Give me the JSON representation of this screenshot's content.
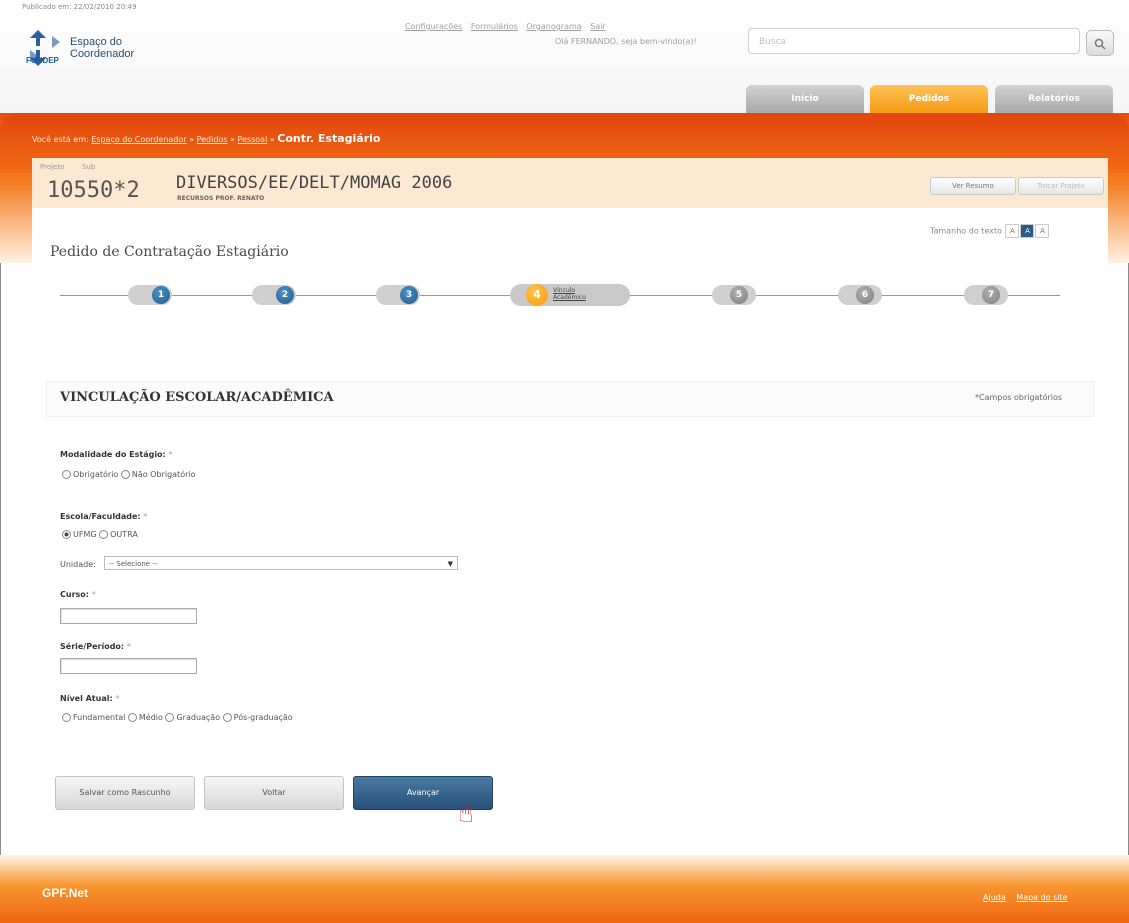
{
  "header": {
    "published": "Publicado em: 22/02/2010 20:49",
    "logo_text_line1": "Espaço do",
    "logo_text_line2": "Coordenador",
    "logo_brand": "FUNDEP",
    "links": [
      "Configurações",
      "Formulários",
      "Organograma",
      "Sair"
    ],
    "greeting": "Olá FERNANDO, seja bem-vindo(a)!",
    "search_placeholder": "Busca"
  },
  "tabs": [
    {
      "label": "Início",
      "active": false
    },
    {
      "label": "Pedidos",
      "active": true
    },
    {
      "label": "Relatórios",
      "active": false
    }
  ],
  "breadcrumb": {
    "prefix": "Você está em:",
    "items": [
      "Espaço do Coordenador",
      "Pedidos",
      "Pessoal"
    ],
    "separator": "»",
    "current": "Contr. Estagiário"
  },
  "project": {
    "projeto_label": "Projeto",
    "sub_label": "Sub",
    "number": "10550*2",
    "name": "DIVERSOS/EE/DELT/MOMAG 2006",
    "subtitle": "RECURSOS PROF. RENATO",
    "ver_resumo": "Ver Resumo",
    "trocar_projeto": "Trocar Projeto"
  },
  "text_size": {
    "label": "Tamanho do texto",
    "options": [
      "A",
      "A",
      "A"
    ],
    "active_index": 1
  },
  "page_title": "Pedido de Contratação Estagiário",
  "steps": [
    {
      "num": "1",
      "state": "done"
    },
    {
      "num": "2",
      "state": "done"
    },
    {
      "num": "3",
      "state": "done"
    },
    {
      "num": "4",
      "state": "current",
      "label_line1": "Vínculo",
      "label_line2": "Acadêmico"
    },
    {
      "num": "5",
      "state": "pending"
    },
    {
      "num": "6",
      "state": "pending"
    },
    {
      "num": "7",
      "state": "pending"
    }
  ],
  "section": {
    "title": "VINCULAÇÃO ESCOLAR/ACADÊMICA",
    "required_note": "*Campos obrigatórios"
  },
  "form": {
    "modalidade": {
      "label": "Modalidade do Estágio:",
      "options": [
        "Obrigatório",
        "Não Obrigatório"
      ],
      "selected": null
    },
    "escola": {
      "label": "Escola/Faculdade:",
      "options": [
        "UFMG",
        "OUTRA"
      ],
      "selected": "UFMG"
    },
    "unidade": {
      "label": "Unidade:",
      "value": "-- Selecione --"
    },
    "curso": {
      "label": "Curso:",
      "value": ""
    },
    "serie": {
      "label": "Série/Período:",
      "value": ""
    },
    "nivel": {
      "label": "Nível Atual:",
      "options": [
        "Fundamental",
        "Médio",
        "Graduação",
        "Pós-graduação"
      ],
      "selected": null
    },
    "required_mark": "*"
  },
  "buttons": {
    "save_draft": "Salvar como Rascunho",
    "back": "Voltar",
    "next": "Avançar"
  },
  "footer": {
    "logo": "GPF.Net",
    "links": [
      "Ajuda",
      "Mapa do site"
    ]
  }
}
